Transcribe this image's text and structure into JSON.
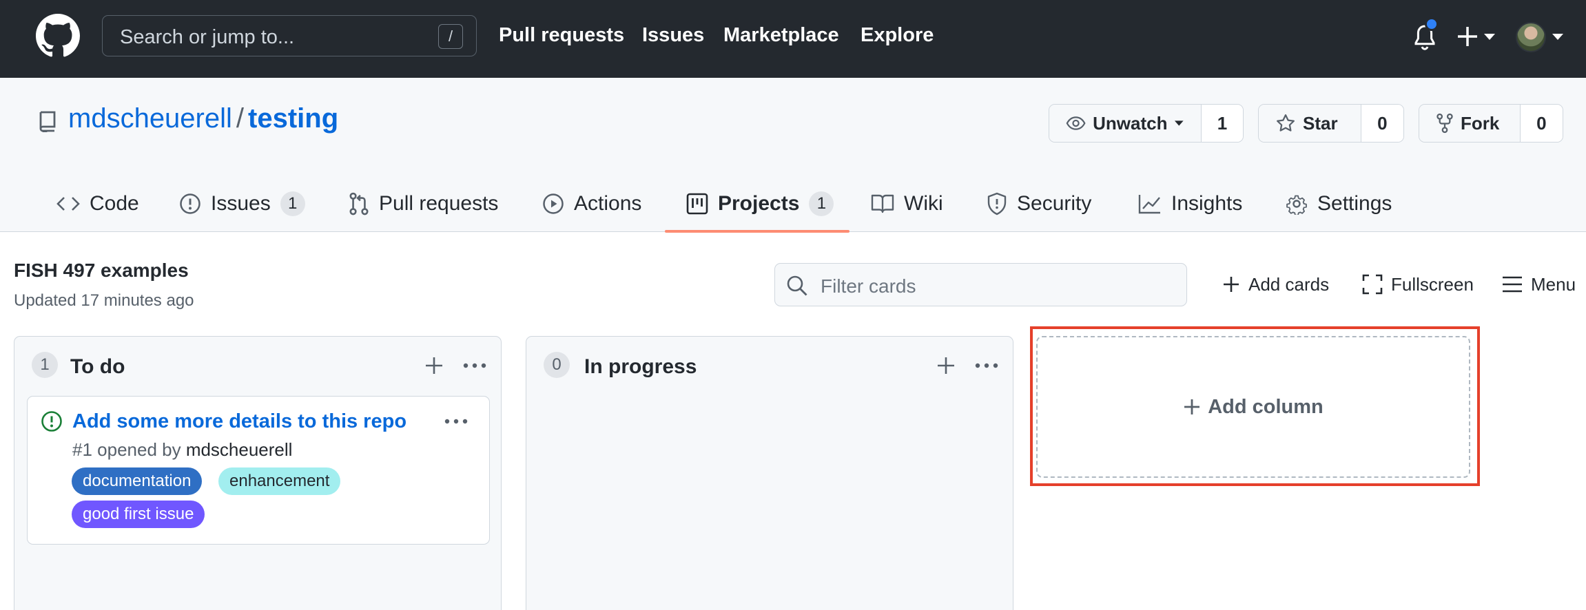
{
  "header": {
    "search_placeholder": "Search or jump to...",
    "search_shortcut": "/",
    "nav": [
      "Pull requests",
      "Issues",
      "Marketplace",
      "Explore"
    ]
  },
  "repo": {
    "owner": "mdscheuerell",
    "separator": "/",
    "name": "testing",
    "watch_label": "Unwatch",
    "watch_count": "1",
    "star_label": "Star",
    "star_count": "0",
    "fork_label": "Fork",
    "fork_count": "0"
  },
  "tabs": [
    {
      "label": "Code",
      "icon": "code-icon"
    },
    {
      "label": "Issues",
      "icon": "issue-opened-icon",
      "count": "1"
    },
    {
      "label": "Pull requests",
      "icon": "git-pull-request-icon"
    },
    {
      "label": "Actions",
      "icon": "play-icon"
    },
    {
      "label": "Projects",
      "icon": "project-icon",
      "count": "1",
      "active": true
    },
    {
      "label": "Wiki",
      "icon": "book-icon"
    },
    {
      "label": "Security",
      "icon": "shield-icon"
    },
    {
      "label": "Insights",
      "icon": "graph-icon"
    },
    {
      "label": "Settings",
      "icon": "gear-icon"
    }
  ],
  "project": {
    "title": "FISH 497 examples",
    "updated": "Updated 17 minutes ago",
    "filter_placeholder": "Filter cards",
    "add_cards": "Add cards",
    "fullscreen": "Fullscreen",
    "menu": "Menu"
  },
  "columns": [
    {
      "name": "To do",
      "count": "1",
      "cards": [
        {
          "title": "Add some more details to this repo",
          "meta_prefix": "#1 opened by ",
          "author": "mdscheuerell",
          "labels": [
            {
              "name": "documentation",
              "bg": "#2f6fc4",
              "fg": "#ffffff"
            },
            {
              "name": "enhancement",
              "bg": "#a2eeef",
              "fg": "#24292f"
            },
            {
              "name": "good first issue",
              "bg": "#7057ff",
              "fg": "#ffffff"
            }
          ]
        }
      ]
    },
    {
      "name": "In progress",
      "count": "0",
      "cards": []
    }
  ],
  "add_column": "Add column",
  "colors": {
    "header_bg": "#24292f",
    "link": "#0969da",
    "active_tab": "#fd8c73",
    "highlight": "#e5402b",
    "issue_open": "#1a7f37"
  }
}
